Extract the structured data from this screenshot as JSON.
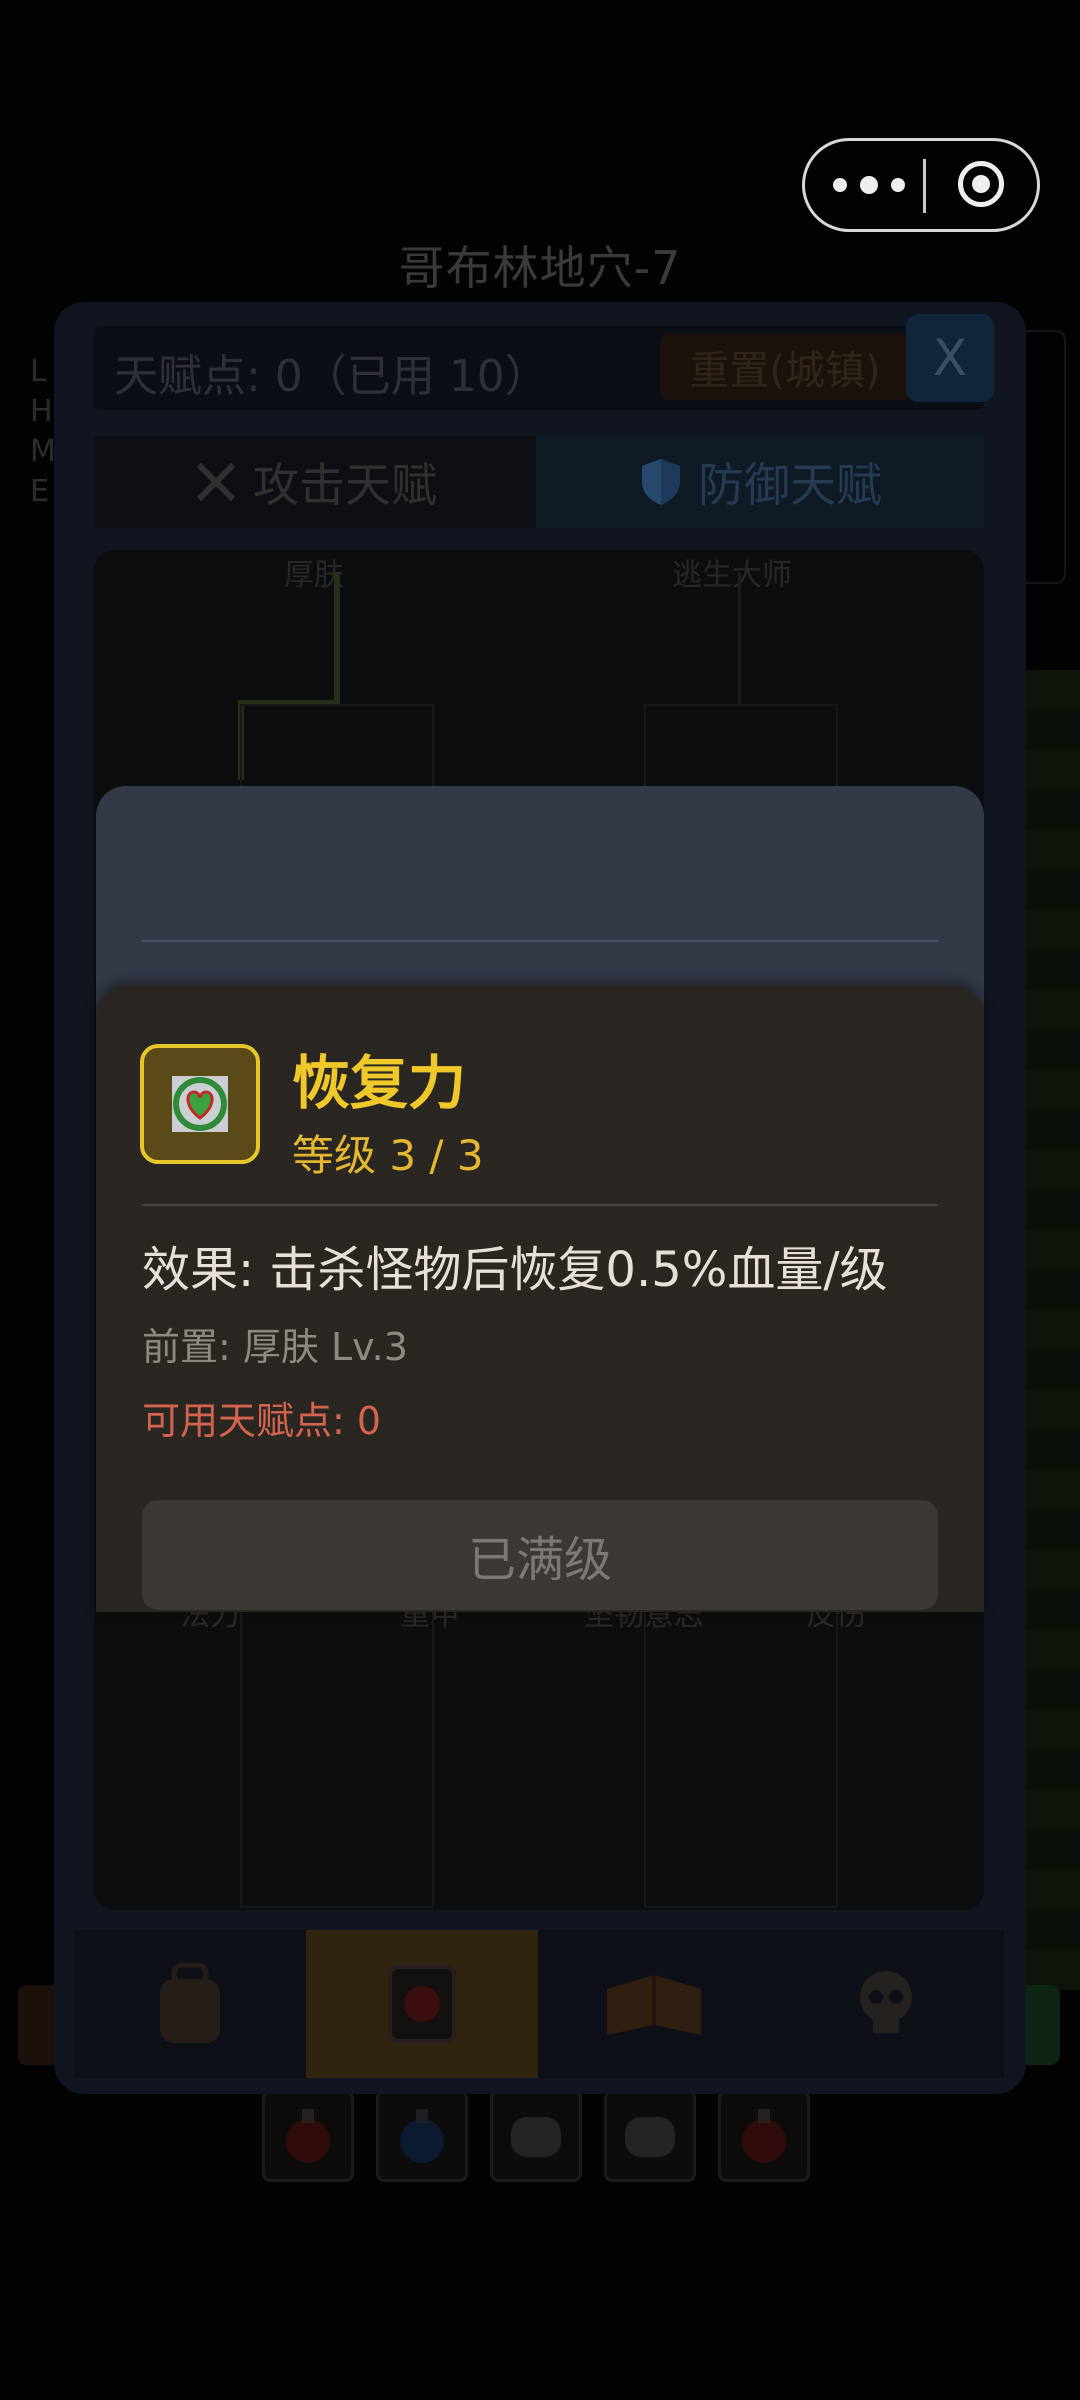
{
  "scene": {
    "location_title": "哥布林地穴-7",
    "side_stats": [
      "L",
      "H",
      "M",
      "E"
    ]
  },
  "talent_panel": {
    "points_text": "天赋点: 0（已用 10）",
    "reset_button": "重置(城镇)",
    "close_button": "X",
    "tabs": [
      {
        "label": "攻击天赋",
        "icon": "crossed-swords-icon",
        "active": false
      },
      {
        "label": "防御天赋",
        "icon": "shield-icon",
        "active": true
      }
    ],
    "tree_nodes_top": [
      "厚肤",
      "逃生大师"
    ],
    "tree_nodes_bottom": [
      "法力",
      "重甲",
      "坚韧意志",
      "反伤"
    ],
    "nav_items": [
      {
        "name": "backpack",
        "icon": "backpack-icon",
        "active": false
      },
      {
        "name": "talents",
        "icon": "rune-book-icon",
        "active": true
      },
      {
        "name": "spellbook",
        "icon": "open-book-icon",
        "active": false
      },
      {
        "name": "bestiary",
        "icon": "skull-icon",
        "active": false
      }
    ]
  },
  "quick_slots": [
    {
      "icon": "red-potion-icon"
    },
    {
      "icon": "blue-potion-icon"
    },
    {
      "icon": "scroll-icon"
    },
    {
      "icon": "scroll-icon"
    },
    {
      "icon": "red-potion-icon"
    }
  ],
  "detail": {
    "icon": "green-heart-vine-icon",
    "name": "恢复力",
    "level": "等级 3 / 3",
    "effect": "效果: 击杀怪物后恢复0.5%血量/级",
    "prerequisite": "前置: 厚肤 Lv.3",
    "available_points": "可用天赋点: 0",
    "action_button": "已满级"
  },
  "colors": {
    "accent_gold": "#f0c82a",
    "warning_red": "#d5644e",
    "panel_bg": "#2a2622"
  }
}
